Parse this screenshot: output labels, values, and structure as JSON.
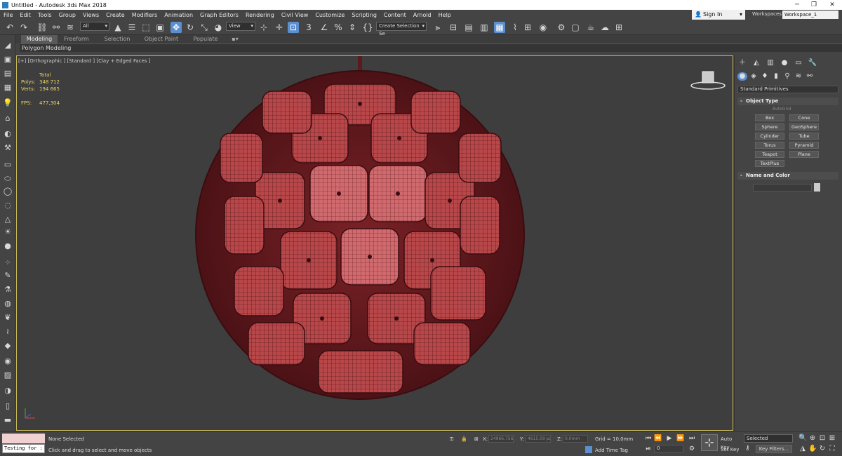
{
  "window": {
    "title": "Untitled - Autodesk 3ds Max 2018",
    "min": "─",
    "max": "❐",
    "close": "✕"
  },
  "menu": [
    "File",
    "Edit",
    "Tools",
    "Group",
    "Views",
    "Create",
    "Modifiers",
    "Animation",
    "Graph Editors",
    "Rendering",
    "Civil View",
    "Customize",
    "Scripting",
    "Content",
    "Arnold",
    "Help"
  ],
  "account": {
    "sign_in": "Sign In",
    "workspaces_label": "Workspaces:",
    "workspace": "Workspace_1"
  },
  "toolbar": {
    "selection_filter": "All",
    "ref_coord": "View",
    "named_selection": "Create Selection Se",
    "snap_angle": "3",
    "snap_percent": "%"
  },
  "ribbon": {
    "tabs": [
      "Modeling",
      "Freeform",
      "Selection",
      "Object Paint",
      "Populate"
    ],
    "active": "Modeling",
    "sub": "Polygon Modeling"
  },
  "viewport": {
    "label": "[+] [Orthographic ] [Standard ] [Clay + Edged Faces ]",
    "stats": {
      "total_label": "Total",
      "polys_label": "Polys:",
      "polys": "348 712",
      "verts_label": "Verts:",
      "verts": "194 665",
      "fps_label": "FPS:",
      "fps": "477,304"
    }
  },
  "command_panel": {
    "dropdown": "Standard Primitives",
    "object_type": "Object Type",
    "autogrid": "AutoGrid",
    "buttons": [
      "Box",
      "Cone",
      "Sphere",
      "GeoSphere",
      "Cylinder",
      "Tube",
      "Torus",
      "Pyramid",
      "Teapot",
      "Plane",
      "TextPlus"
    ],
    "name_color": "Name and Color"
  },
  "status": {
    "selected": "None Selected",
    "prompt": "Click and drag to select and move objects",
    "maxscript": "Testing for :",
    "x_label": "X:",
    "x": "24966,756",
    "y_label": "Y:",
    "y": "4615,09 px",
    "z_label": "Z:",
    "z": "0,0mm",
    "grid": "Grid = 10,0mm",
    "add_time_tag": "Add Time Tag",
    "frame": "0",
    "auto_key": "Auto Key",
    "set_key": "Set Key",
    "selected_dropdown": "Selected",
    "key_filters": "Key Filters..."
  },
  "colors": {
    "accent": "#5b8fd0",
    "viewport_border": "#c8b85a",
    "model": "#b8474a",
    "model_dark": "#6e1e22",
    "stat_text": "#e8d36a"
  }
}
